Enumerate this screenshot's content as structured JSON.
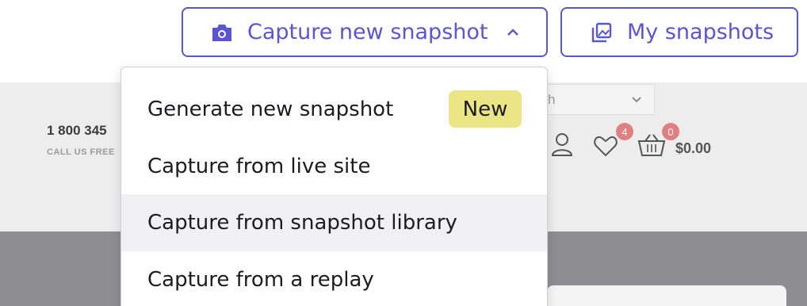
{
  "toolbar": {
    "capture_label": "Capture new snapshot",
    "my_snapshots_label": "My snapshots",
    "accent_color": "#5a55d2"
  },
  "dropdown": {
    "items": [
      {
        "label": "Generate new snapshot",
        "badge": "New"
      },
      {
        "label": "Capture from live site"
      },
      {
        "label": "Capture from snapshot library"
      },
      {
        "label": "Capture from a replay"
      }
    ]
  },
  "site_preview": {
    "phone": "1 800 345",
    "call_label": "CALL US FREE",
    "language_fragment": "lish",
    "wishlist_count": "4",
    "cart_count": "0",
    "cart_total": "$0.00"
  }
}
